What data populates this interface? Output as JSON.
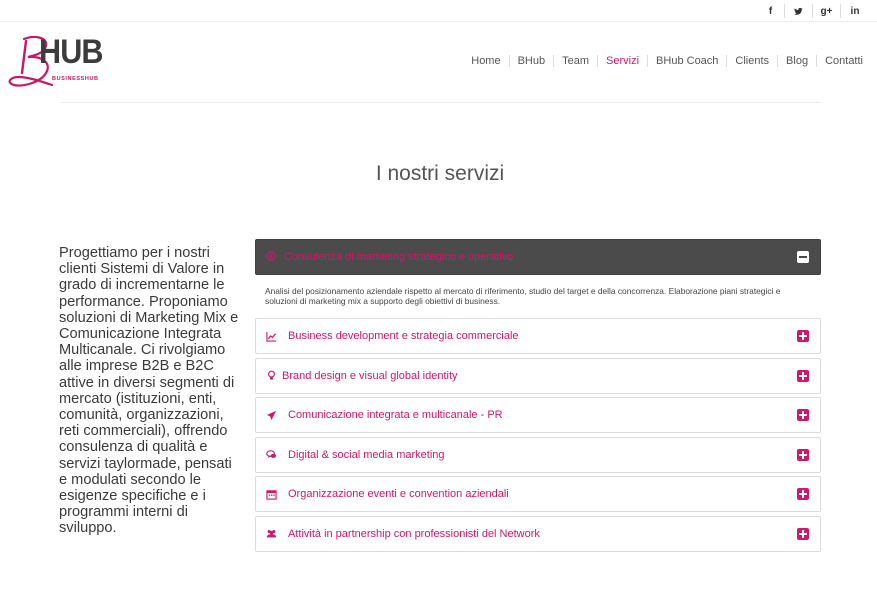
{
  "social": [
    {
      "name": "facebook-icon",
      "glyph": "f"
    },
    {
      "name": "twitter-icon",
      "glyph": "t"
    },
    {
      "name": "google-plus-icon",
      "glyph": "g+"
    },
    {
      "name": "linkedin-icon",
      "glyph": "in"
    }
  ],
  "logo": {
    "letter": "B",
    "text": "HUB",
    "tagline": "BUSINESSHUB"
  },
  "nav": {
    "items": [
      "Home",
      "BHub",
      "Team",
      "Servizi",
      "BHub Coach",
      "Clients",
      "Blog",
      "Contatti"
    ],
    "active": "Servizi"
  },
  "page_title": "I nostri servizi",
  "intro": "Progettiamo per i nostri clienti Sistemi di Valore in grado di incrementarne le performance. Proponiamo soluzioni di Marketing Mix e Comunicazione Integrata Multicanale. Ci rivolgiamo alle imprese B2B e B2C attive in diversi segmenti di mercato (istituzioni, enti, comunità, organizzazioni, reti commerciali), offrendo consulenza di qualità e servizi taylormade, pensati e modulati secondo le esigenze specifiche e i programmi interni di sviluppo.",
  "accordion": {
    "open": {
      "icon": "target-icon",
      "title": "Consulenza di marketing strategico e operativo",
      "body": "Analisi del posizionamento aziendale rispetto al mercato di riferimento, studio del target e della concorrenza. Elaborazione piani strategici e soluzioni di marketing mix a supporto degli obiettivi di business."
    },
    "items": [
      {
        "icon": "line-chart-icon",
        "title": "Business development e strategia commerciale"
      },
      {
        "icon": "lightbulb-icon",
        "title": "Brand design e visual global identity"
      },
      {
        "icon": "paper-plane-icon",
        "title": "Comunicazione integrata e multicanale - PR"
      },
      {
        "icon": "chat-bubbles-icon",
        "title": "Digital & social media marketing"
      },
      {
        "icon": "calendar-icon",
        "title": "Organizzazione eventi e convention aziendali"
      },
      {
        "icon": "users-icon",
        "title": "Attività in partnership con professionisti del Network"
      }
    ]
  },
  "colors": {
    "accent": "#d0176a",
    "dark_panel": "#4b4b4b",
    "text": "#3a3a3a"
  }
}
